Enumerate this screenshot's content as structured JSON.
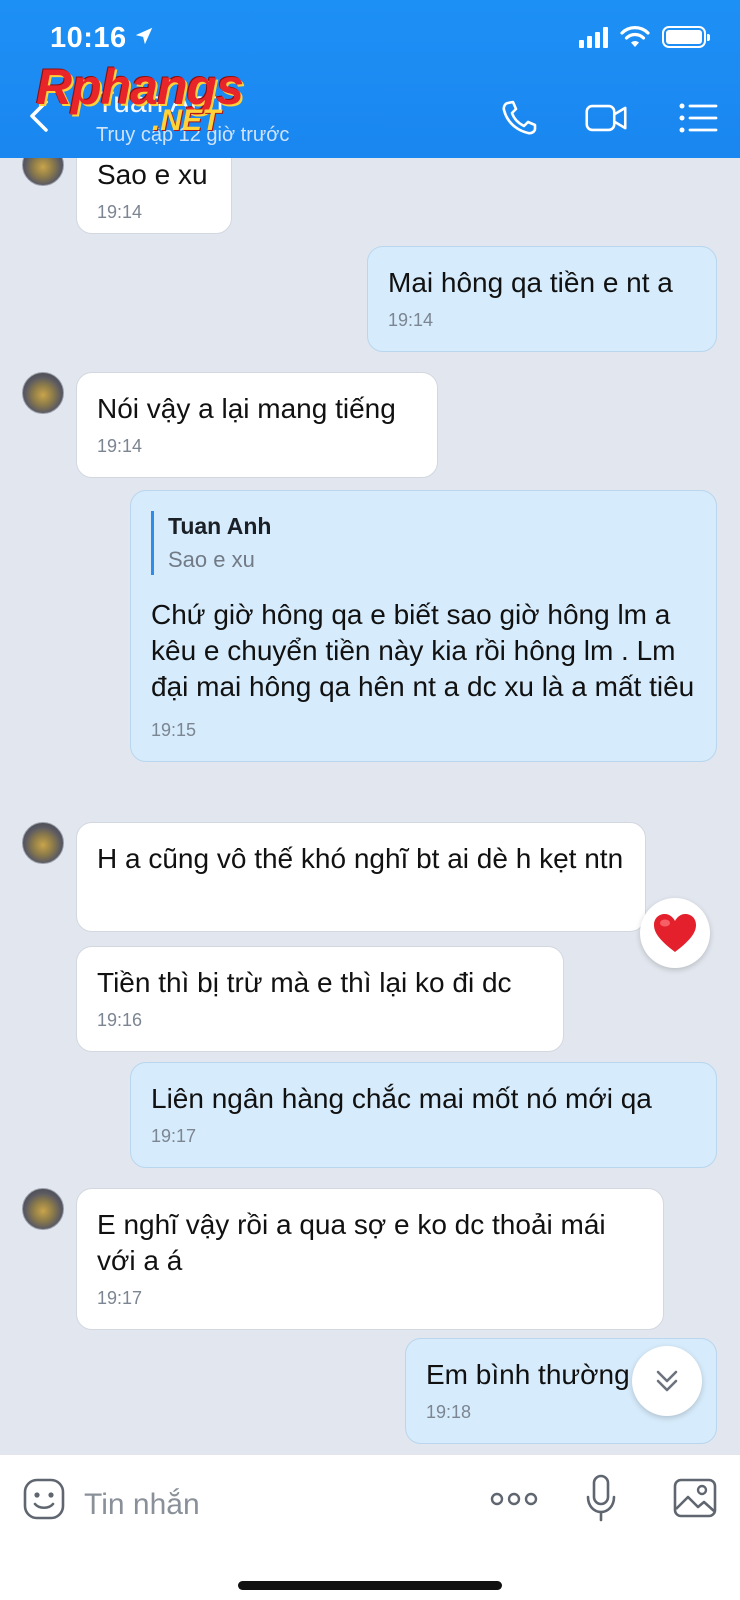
{
  "status_bar": {
    "time": "10:16"
  },
  "header": {
    "contact_name": "Tuan Anh",
    "contact_status": "Truy cập 12 giờ trước",
    "watermark": "Rphangs",
    "watermark_suffix": ".NET",
    "icons": [
      "back-icon",
      "phone-icon",
      "video-call-icon",
      "menu-list-icon"
    ],
    "accent_color": "#1a8cf2"
  },
  "messages": [
    {
      "dir": "in",
      "text": "Sao e xu",
      "time": "19:14"
    },
    {
      "dir": "out",
      "text": "Mai hông qa tiền e nt a",
      "time": "19:14"
    },
    {
      "dir": "in",
      "text": "Nói vậy a lại mang tiếng",
      "time": "19:14"
    },
    {
      "dir": "out",
      "quote_name": "Tuan Anh",
      "quote_text": "Sao e xu",
      "text": "Chứ giờ hông qa e biết sao giờ hông lm a kêu e chuyển tiền này kia rồi hông lm . Lm đại mai hông qa hên nt a dc xu là a mất tiêu",
      "time": "19:15"
    },
    {
      "dir": "in",
      "text": "H a cũng vô thế khó nghĩ bt ai dè h kẹt ntn",
      "reaction": "heart"
    },
    {
      "dir": "in",
      "text": "Tiền thì bị trừ mà e thì lại ko đi dc",
      "time": "19:16"
    },
    {
      "dir": "out",
      "text": "Liên ngân hàng chắc mai mốt nó mới qa",
      "time": "19:17"
    },
    {
      "dir": "in",
      "text": "E nghĩ vậy rồi a qua sợ e ko dc thoải mái với a á",
      "time": "19:17"
    },
    {
      "dir": "out",
      "text": "Em bình thường",
      "time": "19:18"
    }
  ],
  "input_bar": {
    "placeholder": "Tin nhắn",
    "icons": [
      "sticker-icon",
      "more-icon",
      "microphone-icon",
      "gallery-icon"
    ]
  }
}
